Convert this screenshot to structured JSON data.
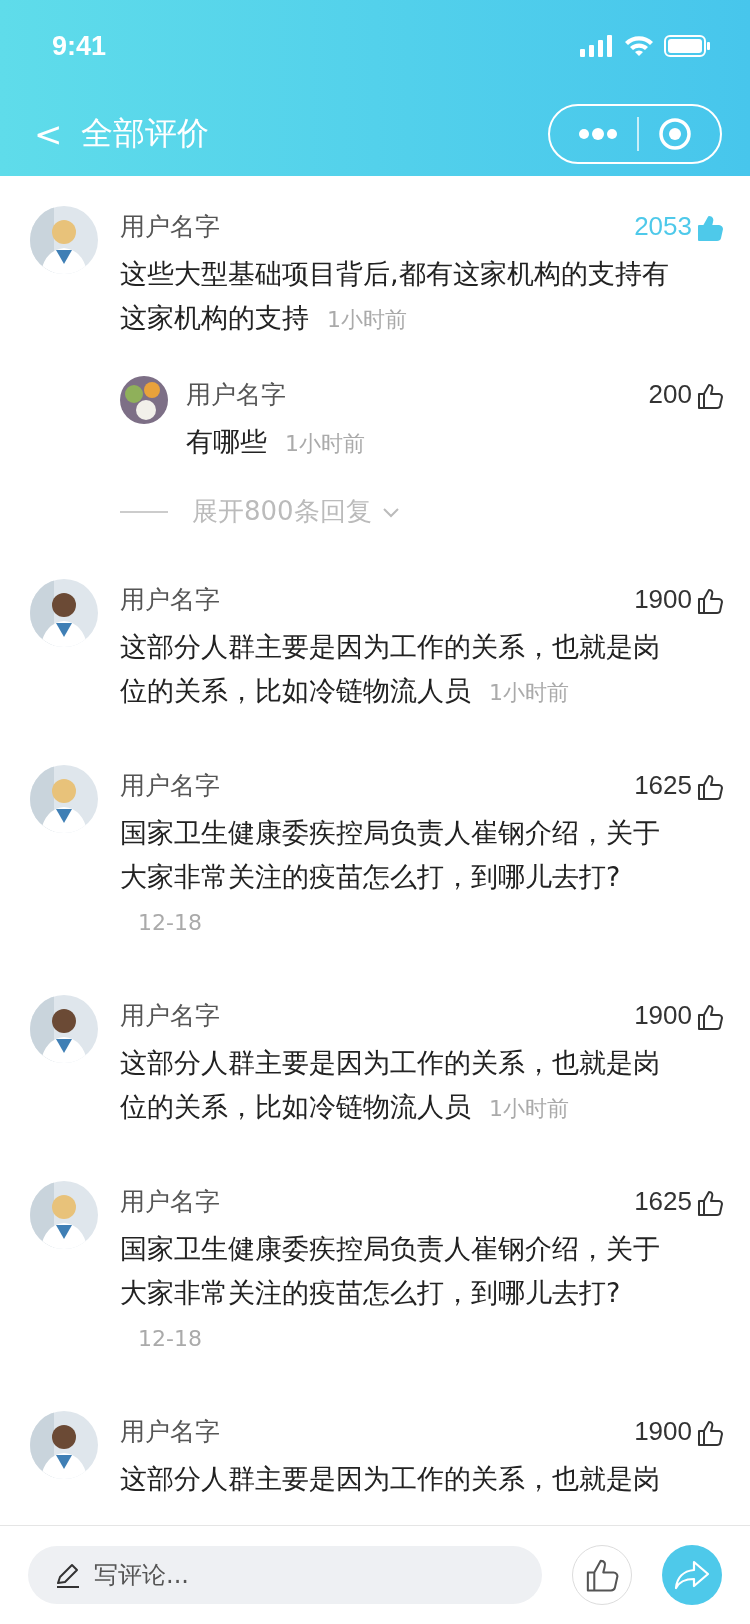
{
  "status_bar": {
    "time": "9:41"
  },
  "nav": {
    "back": "<",
    "title": "全部评价"
  },
  "comments": [
    {
      "name": "用户名字",
      "count": "2053",
      "liked": true,
      "text": "这些大型基础项目背后,都有这家机构的支持有这家机构的支持",
      "time": "1小时前",
      "children": [
        {
          "name": "用户名字",
          "count": "200",
          "liked": false,
          "text": "有哪些",
          "time": "1小时前"
        }
      ],
      "expand": "展开800条回复"
    },
    {
      "name": "用户名字",
      "count": "1900",
      "liked": false,
      "text": "这部分人群主要是因为工作的关系，也就是岗位的关系，比如冷链物流人员",
      "time": "1小时前"
    },
    {
      "name": "用户名字",
      "count": "1625",
      "liked": false,
      "text": "国家卫生健康委疾控局负责人崔钢介绍，关于大家非常关注的疫苗怎么打，到哪儿去打?",
      "time": "12-18"
    },
    {
      "name": "用户名字",
      "count": "1900",
      "liked": false,
      "text": "这部分人群主要是因为工作的关系，也就是岗位的关系，比如冷链物流人员",
      "time": "1小时前"
    },
    {
      "name": "用户名字",
      "count": "1625",
      "liked": false,
      "text": "国家卫生健康委疾控局负责人崔钢介绍，关于大家非常关注的疫苗怎么打，到哪儿去打?",
      "time": "12-18"
    },
    {
      "name": "用户名字",
      "count": "1900",
      "liked": false,
      "text": "这部分人群主要是因为工作的关系，也就是岗"
    }
  ],
  "bottom_bar": {
    "placeholder": "写评论..."
  }
}
